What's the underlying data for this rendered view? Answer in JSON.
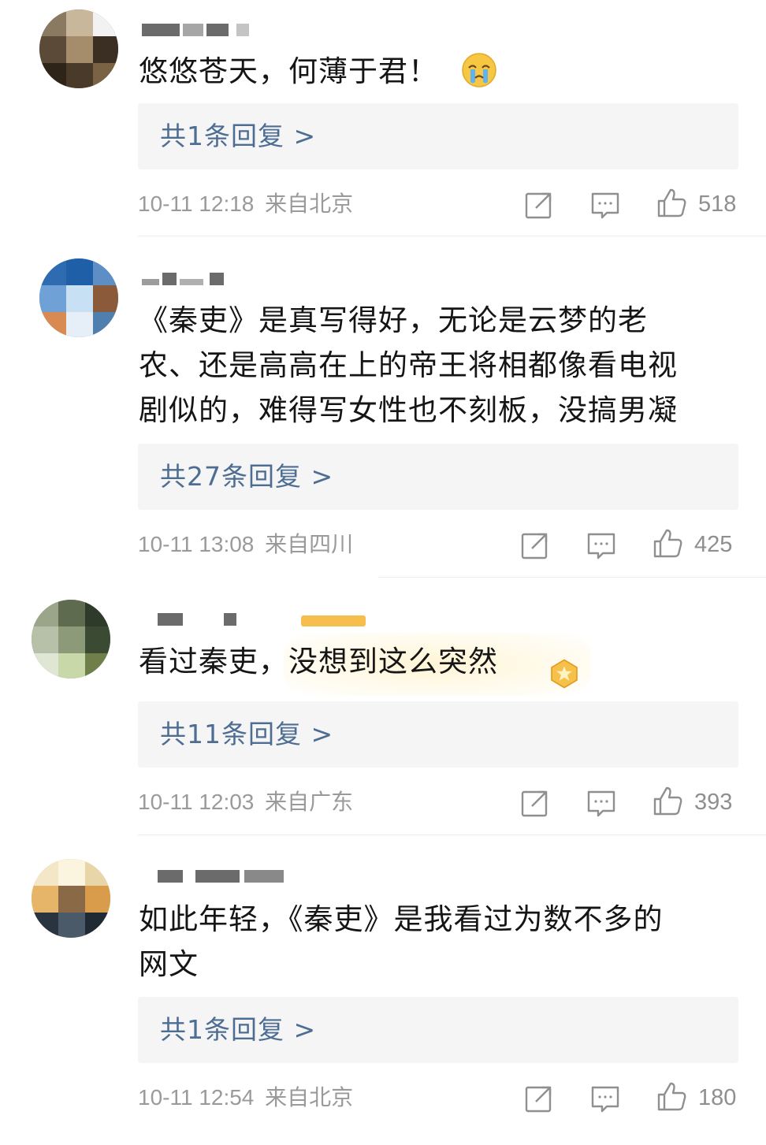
{
  "comments": [
    {
      "text": "悠悠苍天，何薄于君！",
      "reply_label": "共1条回复 >",
      "timestamp": "10-11 12:18",
      "location": "来自北京",
      "likes": "518",
      "emoji": "crying-emoji"
    },
    {
      "text": "《秦吏》是真写得好，无论是云梦的老\n农、还是高高在上的帝王将相都像看电视\n剧似的，难得写女性也不刻板，没搞男凝",
      "reply_label": "共27条回复 >",
      "timestamp": "10-11 13:08",
      "location": "来自四川",
      "likes": "425"
    },
    {
      "text": "看过秦吏，没想到这么突然",
      "reply_label": "共11条回复 >",
      "timestamp": "10-11 12:03",
      "location": "来自广东",
      "likes": "393",
      "badge": "star-badge-icon"
    },
    {
      "text": "如此年轻，《秦吏》是我看过为数不多的\n网文",
      "reply_label": "共1条回复 >",
      "timestamp": "10-11 12:54",
      "location": "来自北京",
      "likes": "180"
    }
  ],
  "icons": {
    "share": "share-icon",
    "comment": "comment-icon",
    "like": "like-icon"
  },
  "colors": {
    "reply_link": "#4e6d93",
    "meta_text": "#9a9a9a",
    "reply_bg": "#f5f5f5"
  }
}
